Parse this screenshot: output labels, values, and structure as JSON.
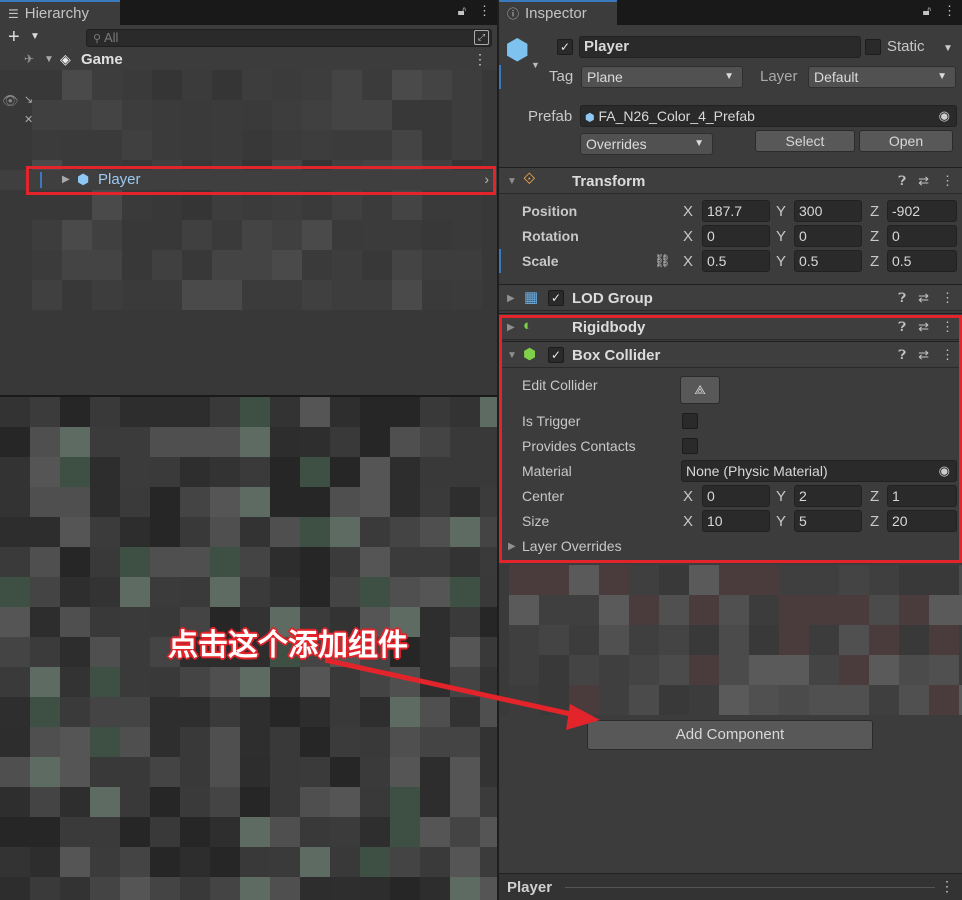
{
  "hierarchy": {
    "tab_title": "Hierarchy",
    "search_placeholder": "All",
    "scene_name": "Game",
    "selected_item": "Player"
  },
  "inspector": {
    "tab_title": "Inspector",
    "object_name": "Player",
    "static_label": "Static",
    "tag_label": "Tag",
    "tag_value": "Plane",
    "layer_label": "Layer",
    "layer_value": "Default",
    "prefab_label": "Prefab",
    "prefab_value": "FA_N26_Color_4_Prefab",
    "overrides_label": "Overrides",
    "select_button": "Select",
    "open_button": "Open",
    "transform": {
      "title": "Transform",
      "position_label": "Position",
      "rotation_label": "Rotation",
      "scale_label": "Scale",
      "position": {
        "x": "187.7",
        "y": "300",
        "z": "-902"
      },
      "rotation": {
        "x": "0",
        "y": "0",
        "z": "0"
      },
      "scale": {
        "x": "0.5",
        "y": "0.5",
        "z": "0.5"
      }
    },
    "lod_group": {
      "title": "LOD Group"
    },
    "rigidbody": {
      "title": "Rigidbody"
    },
    "box_collider": {
      "title": "Box Collider",
      "edit_collider_label": "Edit Collider",
      "is_trigger_label": "Is Trigger",
      "provides_contacts_label": "Provides Contacts",
      "material_label": "Material",
      "material_value": "None (Physic Material)",
      "center_label": "Center",
      "size_label": "Size",
      "center": {
        "x": "0",
        "y": "2",
        "z": "1"
      },
      "size": {
        "x": "10",
        "y": "5",
        "z": "20"
      },
      "layer_overrides_label": "Layer Overrides"
    },
    "add_component_button": "Add Component",
    "footer_title": "Player"
  },
  "axis": {
    "x": "X",
    "y": "Y",
    "z": "Z"
  },
  "annotation": "点击这个添加组件",
  "colors": {
    "highlight": "#e3242b",
    "accent": "#3a79bb"
  }
}
